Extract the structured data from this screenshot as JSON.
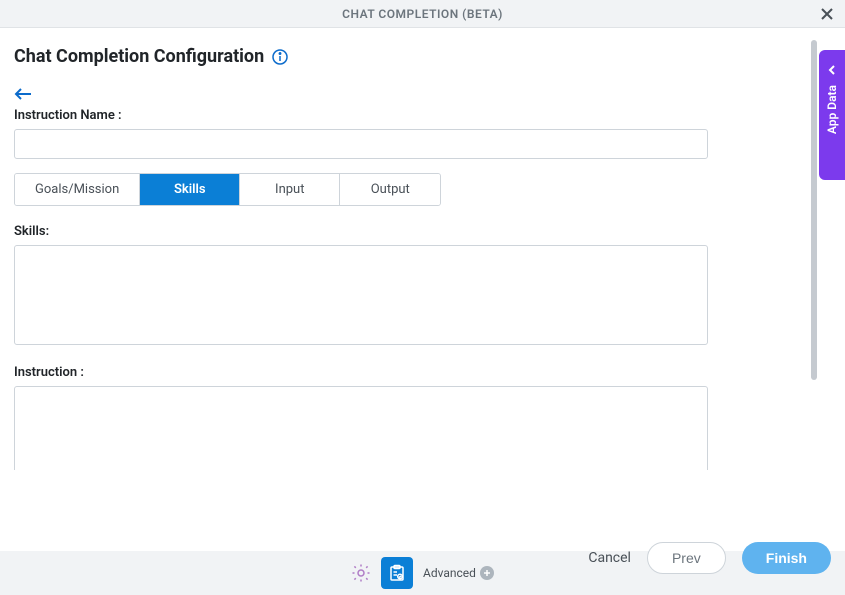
{
  "header": {
    "title": "CHAT COMPLETION (BETA)"
  },
  "page": {
    "title": "Chat Completion Configuration"
  },
  "form": {
    "instruction_name_label": "Instruction Name :",
    "instruction_name_value": "",
    "skills_label": "Skills:",
    "skills_value": "",
    "instruction_label": "Instruction :",
    "instruction_value": ""
  },
  "tabs": [
    {
      "label": "Goals/Mission",
      "active": false
    },
    {
      "label": "Skills",
      "active": true
    },
    {
      "label": "Input",
      "active": false
    },
    {
      "label": "Output",
      "active": false
    }
  ],
  "toolbar": {
    "advanced_label": "Advanced"
  },
  "footer": {
    "cancel_label": "Cancel",
    "prev_label": "Prev",
    "finish_label": "Finish"
  },
  "side_tab": {
    "label": "App Data"
  }
}
